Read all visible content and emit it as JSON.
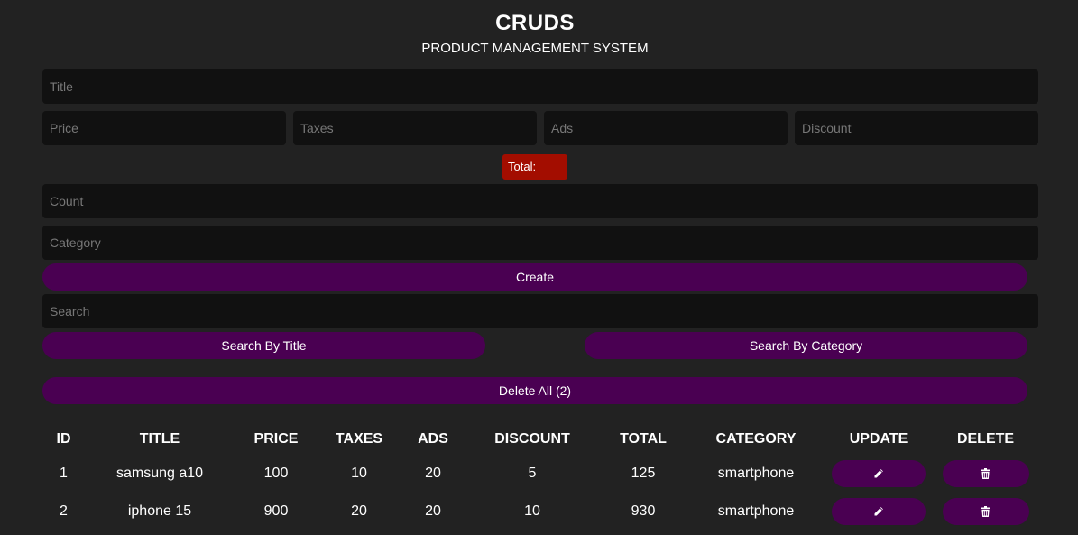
{
  "header": {
    "title": "CRUDS",
    "subtitle": "PRODUCT MANAGEMENT SYSTEM"
  },
  "form": {
    "title_placeholder": "Title",
    "price_placeholder": "Price",
    "taxes_placeholder": "Taxes",
    "ads_placeholder": "Ads",
    "discount_placeholder": "Discount",
    "total_label": "Total:",
    "count_placeholder": "Count",
    "category_placeholder": "Category",
    "create_label": "Create"
  },
  "search": {
    "placeholder": "Search",
    "by_title_label": "Search By Title",
    "by_category_label": "Search By Category"
  },
  "delete_all_label": "Delete All (2)",
  "colors": {
    "background": "#222222",
    "input_background": "#111111",
    "button_purple": "#4a0052",
    "total_red": "#a30d00"
  },
  "table": {
    "headers": [
      "ID",
      "TITLE",
      "PRICE",
      "TAXES",
      "ADS",
      "DISCOUNT",
      "TOTAL",
      "CATEGORY",
      "UPDATE",
      "DELETE"
    ],
    "rows": [
      {
        "id": "1",
        "title": "samsung a10",
        "price": "100",
        "taxes": "10",
        "ads": "20",
        "discount": "5",
        "total": "125",
        "category": "smartphone",
        "update_icon": "pencil-icon",
        "delete_icon": "trash-icon"
      },
      {
        "id": "2",
        "title": "iphone 15",
        "price": "900",
        "taxes": "20",
        "ads": "20",
        "discount": "10",
        "total": "930",
        "category": "smartphone",
        "update_icon": "pencil-icon",
        "delete_icon": "trash-icon"
      }
    ]
  }
}
